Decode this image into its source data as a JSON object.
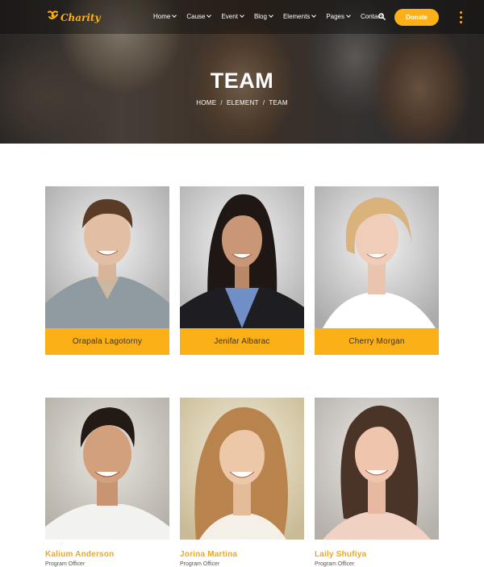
{
  "brand": {
    "name": "Charity",
    "accent": "#fbb018"
  },
  "nav": {
    "items": [
      {
        "label": "Home",
        "dropdown": true
      },
      {
        "label": "Cause",
        "dropdown": true
      },
      {
        "label": "Event",
        "dropdown": true
      },
      {
        "label": "Blog",
        "dropdown": true
      },
      {
        "label": "Elements",
        "dropdown": true
      },
      {
        "label": "Pages",
        "dropdown": true
      },
      {
        "label": "Contact",
        "dropdown": false
      }
    ],
    "search_icon": "search-icon",
    "donate_label": "Donate",
    "more_icon": "kebab-menu-icon"
  },
  "hero": {
    "title": "TEAM",
    "breadcrumb": [
      "HOME",
      "ELEMENT",
      "TEAM"
    ],
    "separator": "/"
  },
  "team_row1": [
    {
      "name": "Orapala Lagotorny"
    },
    {
      "name": "Jenifar Albarac"
    },
    {
      "name": "Cherry Morgan"
    }
  ],
  "team_row2": [
    {
      "name": "Kalium Anderson",
      "role": "Program Officer"
    },
    {
      "name": "Jorina Martina",
      "role": "Program Officer"
    },
    {
      "name": "Laily Shufiya",
      "role": "Program Officer"
    }
  ]
}
